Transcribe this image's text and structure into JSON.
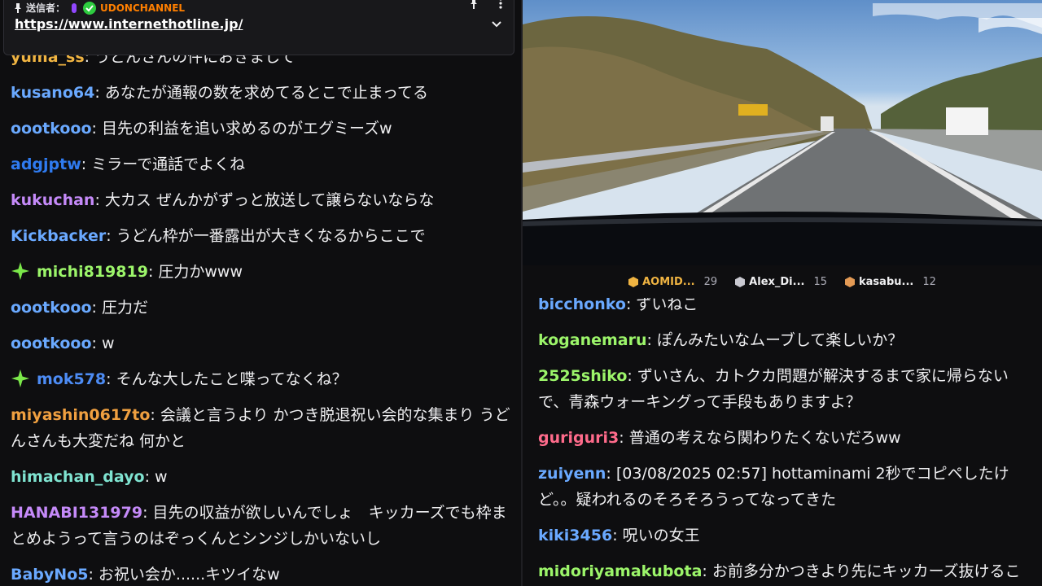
{
  "pinned": {
    "sender_label": "送信者：",
    "channel": "UDONCHANNEL",
    "link": "https://www.internethotline.jp/"
  },
  "left_chat": [
    {
      "user": "yuma_ss",
      "color": "#f0b442",
      "text": "うどんさんの件におきまして"
    },
    {
      "user": "kusano64",
      "color": "#6aa9ff",
      "text": "あなたが通報の数を求めてるとこで止まってる"
    },
    {
      "user": "oootkooo",
      "color": "#6aa9ff",
      "text": "目先の利益を追い求めるのがエグミーズw"
    },
    {
      "user": "adgjptw",
      "color": "#2f7bf0",
      "text": "ミラーで通話でよくね"
    },
    {
      "user": "kukuchan",
      "color": "#c58af9",
      "text": "大カス ぜんかがずっと放送して譲らないならな"
    },
    {
      "user": "Kickbacker",
      "color": "#6aa9ff",
      "text": "うどん枠が一番露出が大きくなるからここで"
    },
    {
      "user": "michi819819",
      "color": "#9cf56a",
      "badge": true,
      "text": "圧力かwww"
    },
    {
      "user": "oootkooo",
      "color": "#6aa9ff",
      "text": "圧力だ"
    },
    {
      "user": "oootkooo",
      "color": "#6aa9ff",
      "text": "w"
    },
    {
      "user": "mok578",
      "color": "#4d8cf5",
      "badge": true,
      "text": "そんな大したこと喋ってなくね？"
    },
    {
      "user": "miyashin0617to",
      "color": "#f0a040",
      "text": "会議と言うより かつき脱退祝い会的な集まり うどんさんも大変だね 何かと"
    },
    {
      "user": "himachan_dayo",
      "color": "#7fe3d0",
      "text": "w"
    },
    {
      "user": "HANABI131979",
      "color": "#c58af9",
      "text": "目先の収益が欲しいんでしょ　キッカーズでも枠まとめようって言うのはぞっくんとシンジしかいないし"
    },
    {
      "user": "BabyNo5",
      "color": "#6aa9ff",
      "text": "お祝い会か......キツイなw"
    }
  ],
  "leaderboard": [
    {
      "name": "AOMID...",
      "count": "29",
      "tier": "gold"
    },
    {
      "name": "Alex_Di...",
      "count": "15",
      "tier": "silver"
    },
    {
      "name": "kasabu...",
      "count": "12",
      "tier": "bronze"
    }
  ],
  "right_chat": [
    {
      "user": "bicchonko",
      "color": "#6aa9ff",
      "text": "ずいねこ"
    },
    {
      "user": "koganemaru",
      "color": "#9cf56a",
      "text": "ぽんみたいなムーブして楽しいか？"
    },
    {
      "user": "2525shiko",
      "color": "#9cf56a",
      "text": "ずいさん、カトクカ問題が解決するまで家に帰らないで、青森ウォーキングって手段もありますよ？"
    },
    {
      "user": "guriguri3",
      "color": "#ff6b8b",
      "text": "普通の考えなら関わりたくないだろww"
    },
    {
      "user": "zuiyenn",
      "color": "#6aa9ff",
      "text": "[03/08/2025 02:57]  hottaminami 2秒でコピペしたけど。。疑われるのそろそろうってなってきた"
    },
    {
      "user": "kiki3456",
      "color": "#6aa9ff",
      "text": "呪いの女王"
    },
    {
      "user": "midoriyamakubota",
      "color": "#9cf56a",
      "text": "お前多分かつきより先にキッカーズ抜けることになる"
    }
  ]
}
